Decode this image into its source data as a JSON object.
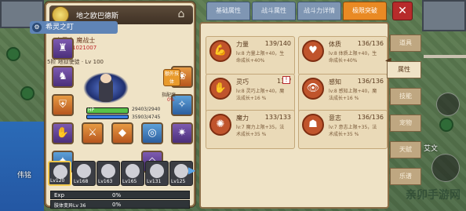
{
  "world": {
    "labels": [
      "伟铭",
      "艾文"
    ]
  },
  "player": {
    "name": "地之欧巴德斯"
  },
  "hero": {
    "class_name": "希灵之叮",
    "title": "变异人 魔战士",
    "power": "战斗力 1021007",
    "tier": "5阶 地狱使徒 · Lv 100",
    "hp_label": "HP",
    "hp_value": "29403/2940",
    "mp_value": "35903/4745",
    "hp_fill": 1.0,
    "mp_fill": 1.0,
    "awaken_label": "额外技体",
    "guide_label": "指配度",
    "guide_pct": "0%"
  },
  "equip_slots": [
    {
      "name": "helmet",
      "icon": "helmet-icon",
      "glyph": "♜",
      "color": "purple"
    },
    {
      "name": "shoulder",
      "icon": "shoulder-icon",
      "glyph": "♞",
      "color": "purple"
    },
    {
      "name": "armor",
      "icon": "armor-icon",
      "glyph": "⛨",
      "color": "orange"
    },
    {
      "name": "gloves",
      "icon": "gloves-icon",
      "glyph": "✋",
      "color": "purple"
    },
    {
      "name": "boots",
      "icon": "boots-icon",
      "glyph": "✦",
      "color": "blue"
    },
    {
      "name": "weapon",
      "icon": "weapon-icon",
      "glyph": "⚔",
      "color": "orange"
    },
    {
      "name": "accessory",
      "icon": "accessory-icon",
      "glyph": "◆",
      "color": "orange"
    },
    {
      "name": "ring",
      "icon": "ring-icon",
      "glyph": "◎",
      "color": "blue"
    },
    {
      "name": "relic",
      "icon": "relic-icon",
      "glyph": "✷",
      "color": "purple"
    },
    {
      "name": "charm",
      "icon": "charm-icon",
      "glyph": "❀",
      "color": "orange"
    },
    {
      "name": "crystal",
      "icon": "crystal-icon",
      "glyph": "✧",
      "color": "blue"
    },
    {
      "name": "gem",
      "icon": "gem-icon",
      "glyph": "◇",
      "color": "purple"
    }
  ],
  "hero_list": [
    {
      "lv": "Lv120",
      "active": true
    },
    {
      "lv": "Lv168",
      "active": false
    },
    {
      "lv": "Lv163",
      "active": false
    },
    {
      "lv": "Lv165",
      "active": false
    },
    {
      "lv": "Lv131",
      "active": false
    },
    {
      "lv": "Lv125",
      "active": false
    }
  ],
  "exp": {
    "label": "Exp",
    "pct": "0%",
    "fill": 0.0
  },
  "evolution": {
    "label": "肢体变异Lv 36",
    "pct": "0%",
    "fill": 0.0
  },
  "tabs": [
    {
      "label": "基础属性",
      "active": false
    },
    {
      "label": "战斗属性",
      "active": false
    },
    {
      "label": "战斗力详情",
      "active": false
    },
    {
      "label": "极限突破",
      "active": true
    }
  ],
  "stats": [
    {
      "name": "力量",
      "value": "139/140",
      "desc1": "lv:8 力量上限+40，生",
      "desc2": "命成长+40%",
      "icon": "strength-icon",
      "glyph": "💪"
    },
    {
      "name": "体质",
      "value": "136/136",
      "desc1": "lv:8 体质上限+40，生",
      "desc2": "命成长+40%",
      "icon": "constitution-icon",
      "glyph": "♥"
    },
    {
      "name": "灵巧",
      "value": "132/",
      "desc1": "lv:8 灵巧上限+40，魔",
      "desc2": "法成长+16 %",
      "icon": "agility-icon",
      "glyph": "✋",
      "warn": "!"
    },
    {
      "name": "感知",
      "value": "136/136",
      "desc1": "lv:8 感知上限+40，魔",
      "desc2": "法成长+16 %",
      "icon": "perception-icon",
      "glyph": "👁"
    },
    {
      "name": "魔力",
      "value": "133/133",
      "desc1": "lv:7 魔力上限+35，法",
      "desc2": "术成长+35 %",
      "icon": "magic-icon",
      "glyph": "✺"
    },
    {
      "name": "意志",
      "value": "136/136",
      "desc1": "lv:7 意志上限+35，法",
      "desc2": "术成长+35 %",
      "icon": "will-icon",
      "glyph": "☗"
    }
  ],
  "side_menu": [
    {
      "label": "道具",
      "active": false
    },
    {
      "label": "属性",
      "active": true
    },
    {
      "label": "技能",
      "active": false
    },
    {
      "label": "宠物",
      "active": false
    },
    {
      "label": "天赋",
      "active": false
    },
    {
      "label": "乐谱",
      "active": false
    }
  ],
  "close_label": "✕",
  "watermark": "亲卯手游网"
}
